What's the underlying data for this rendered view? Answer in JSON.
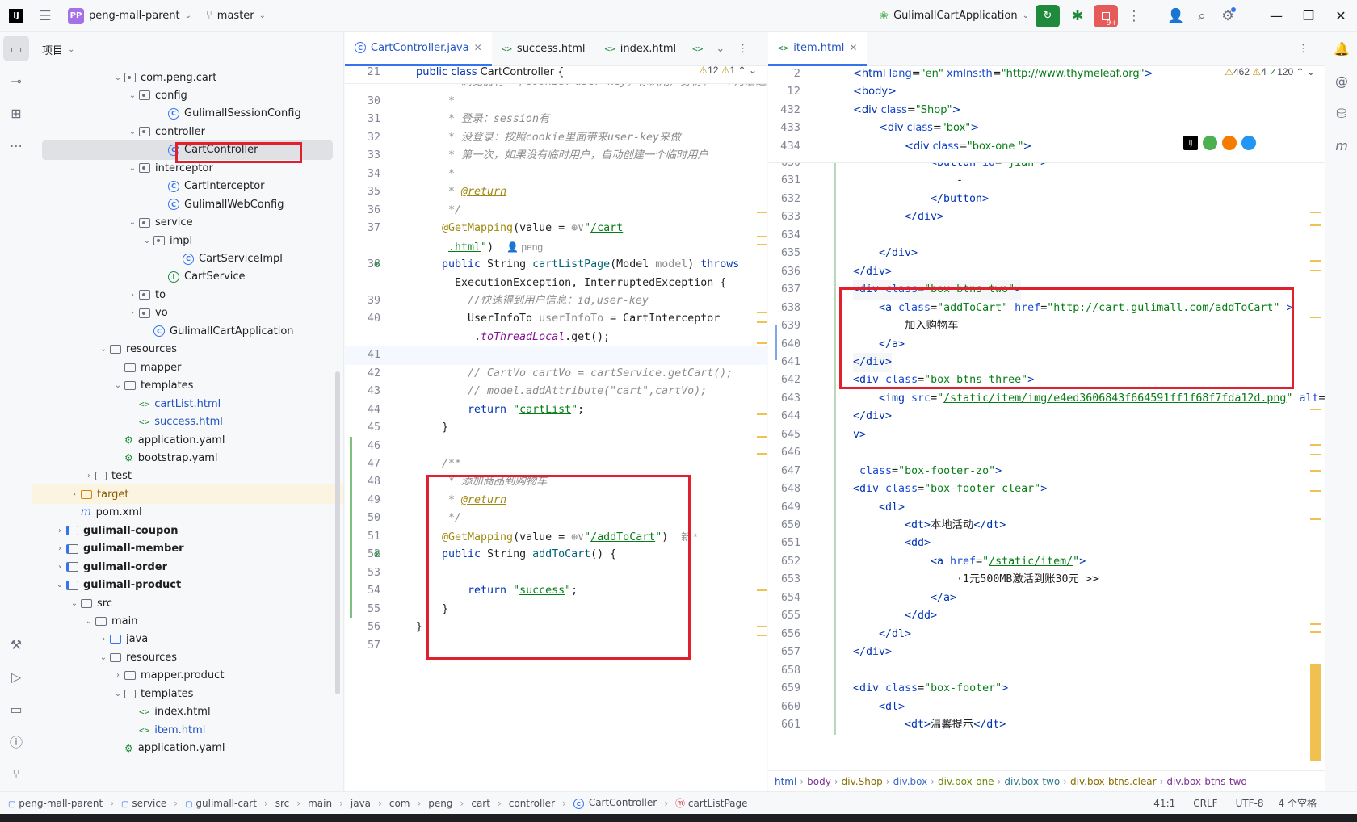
{
  "titlebar": {
    "app_logo": "IJ",
    "project_badge": "PP",
    "project_name": "peng-mall-parent",
    "branch": "master",
    "run_config": "GulimallCartApplication",
    "notif_badge": "9+"
  },
  "project_panel": {
    "title": "项目",
    "tree": [
      {
        "label": "com.peng.cart",
        "icon": "package",
        "depth": 7,
        "arrow": "open"
      },
      {
        "label": "config",
        "icon": "package",
        "depth": 8,
        "arrow": "open"
      },
      {
        "label": "GulimallSessionConfig",
        "icon": "class",
        "depth": 10,
        "arrow": ""
      },
      {
        "label": "controller",
        "icon": "package",
        "depth": 8,
        "arrow": "open"
      },
      {
        "label": "CartController",
        "icon": "class",
        "depth": 10,
        "arrow": "",
        "selected": true,
        "color": "#1e1f22"
      },
      {
        "label": "interceptor",
        "icon": "package",
        "depth": 8,
        "arrow": "open"
      },
      {
        "label": "CartInterceptor",
        "icon": "class",
        "depth": 10,
        "arrow": ""
      },
      {
        "label": "GulimallWebConfig",
        "icon": "class",
        "depth": 10,
        "arrow": ""
      },
      {
        "label": "service",
        "icon": "package",
        "depth": 8,
        "arrow": "open"
      },
      {
        "label": "impl",
        "icon": "package",
        "depth": 9,
        "arrow": "open"
      },
      {
        "label": "CartServiceImpl",
        "icon": "class",
        "depth": 11,
        "arrow": ""
      },
      {
        "label": "CartService",
        "icon": "interface",
        "depth": 10,
        "arrow": ""
      },
      {
        "label": "to",
        "icon": "package",
        "depth": 8,
        "arrow": "closed"
      },
      {
        "label": "vo",
        "icon": "package",
        "depth": 8,
        "arrow": "closed"
      },
      {
        "label": "GulimallCartApplication",
        "icon": "class",
        "depth": 9,
        "arrow": ""
      },
      {
        "label": "resources",
        "icon": "folder",
        "depth": 6,
        "arrow": "open"
      },
      {
        "label": "mapper",
        "icon": "folder",
        "depth": 7,
        "arrow": ""
      },
      {
        "label": "templates",
        "icon": "folder",
        "depth": 7,
        "arrow": "open"
      },
      {
        "label": "cartList.html",
        "icon": "html",
        "depth": 8,
        "arrow": "",
        "color": "#2355c2"
      },
      {
        "label": "success.html",
        "icon": "html",
        "depth": 8,
        "arrow": "",
        "color": "#2355c2"
      },
      {
        "label": "application.yaml",
        "icon": "yaml",
        "depth": 7,
        "arrow": ""
      },
      {
        "label": "bootstrap.yaml",
        "icon": "yaml",
        "depth": 7,
        "arrow": ""
      },
      {
        "label": "test",
        "icon": "folder",
        "depth": 5,
        "arrow": "closed"
      },
      {
        "label": "target",
        "icon": "folder-orange",
        "depth": 4,
        "arrow": "closed",
        "highlight": true,
        "color": "#8a5a00"
      },
      {
        "label": "pom.xml",
        "icon": "maven",
        "depth": 4,
        "arrow": ""
      },
      {
        "label": "gulimall-coupon",
        "icon": "module",
        "depth": 3,
        "arrow": "closed",
        "bold": true
      },
      {
        "label": "gulimall-member",
        "icon": "module",
        "depth": 3,
        "arrow": "closed",
        "bold": true
      },
      {
        "label": "gulimall-order",
        "icon": "module",
        "depth": 3,
        "arrow": "closed",
        "bold": true
      },
      {
        "label": "gulimall-product",
        "icon": "module",
        "depth": 3,
        "arrow": "open",
        "bold": true
      },
      {
        "label": "src",
        "icon": "folder",
        "depth": 4,
        "arrow": "open"
      },
      {
        "label": "main",
        "icon": "folder",
        "depth": 5,
        "arrow": "open"
      },
      {
        "label": "java",
        "icon": "folder-blue",
        "depth": 6,
        "arrow": "closed"
      },
      {
        "label": "resources",
        "icon": "folder",
        "depth": 6,
        "arrow": "open"
      },
      {
        "label": "mapper.product",
        "icon": "folder",
        "depth": 7,
        "arrow": "closed"
      },
      {
        "label": "templates",
        "icon": "folder",
        "depth": 7,
        "arrow": "open"
      },
      {
        "label": "index.html",
        "icon": "html",
        "depth": 8,
        "arrow": ""
      },
      {
        "label": "item.html",
        "icon": "html",
        "depth": 8,
        "arrow": "",
        "color": "#2355c2"
      },
      {
        "label": "application.yaml",
        "icon": "yaml",
        "depth": 7,
        "arrow": ""
      }
    ]
  },
  "left_editor": {
    "tabs": [
      {
        "label": "CartController.java",
        "icon": "C",
        "active": true
      },
      {
        "label": "success.html",
        "icon": "<>",
        "active": false
      },
      {
        "label": "index.html",
        "icon": "<>",
        "active": false
      }
    ],
    "warnings": "12",
    "weak": "1",
    "sticky": {
      "num": "21",
      "html": "<span class=\"kw\">public class</span> CartController {"
    },
    "lines": [
      {
        "num": "30",
        "indent": 1,
        "html": "<span class=\"cm\"> *</span>"
      },
      {
        "num": "31",
        "indent": 1,
        "html": "<span class=\"cm\"> * 登录：session有</span>"
      },
      {
        "num": "32",
        "indent": 1,
        "html": "<span class=\"cm\"> * 没登录：按照cookie里面带来user-key来做</span>"
      },
      {
        "num": "33",
        "indent": 1,
        "html": "<span class=\"cm\"> * 第一次，如果没有临时用户，自动创建一个临时用户</span>"
      },
      {
        "num": "34",
        "indent": 1,
        "html": "<span class=\"cm\"> *</span>"
      },
      {
        "num": "35",
        "indent": 1,
        "html": "<span class=\"cm\"> * </span><span class=\"ann\" style=\"font-style:italic;text-decoration:underline\">@return</span>"
      },
      {
        "num": "36",
        "indent": 1,
        "html": "<span class=\"cm\"> */</span>"
      },
      {
        "num": "37",
        "indent": 1,
        "html": "<span class=\"ann\">@GetMapping</span>(value = <span class=\"gray\">⊕∨</span><span class=\"str\">\"<u>/cart</u></span>"
      },
      {
        "num": "",
        "indent": 1,
        "html": "<span class=\"str\"> <u>.html</u>\"</span>)  <span class=\"gray\" style=\"font-family:'Liberation Sans',sans-serif;font-size:12px\">👤 peng</span>"
      },
      {
        "num": "38",
        "indent": 1,
        "html": "<span class=\"kw\">public</span> String <span class=\"fn\">cartListPage</span>(Model <span class=\"gray\">model</span>) <span class=\"kw\">throws</span>"
      },
      {
        "num": "",
        "indent": 1,
        "html": "  ExecutionException, InterruptedException {"
      },
      {
        "num": "39",
        "indent": 2,
        "html": "<span class=\"cm\">//快速得到用户信息：id,user-key</span>"
      },
      {
        "num": "40",
        "indent": 2,
        "html": "UserInfoTo <span class=\"gray\">userInfoTo</span> = CartInterceptor"
      },
      {
        "num": "",
        "indent": 2,
        "html": " .<span class=\"ital\">toThreadLocal</span>.get();"
      },
      {
        "num": "41",
        "indent": 2,
        "html": ""
      },
      {
        "num": "42",
        "indent": 2,
        "html": "<span class=\"cm\">// CartVo cartVo = cartService.getCart();</span>"
      },
      {
        "num": "43",
        "indent": 2,
        "html": "<span class=\"cm\">// model.addAttribute(\"cart\",cartVo);</span>"
      },
      {
        "num": "44",
        "indent": 2,
        "html": "<span class=\"kw\">return</span> <span class=\"str\">\"<u>cartList</u>\"</span>;"
      },
      {
        "num": "45",
        "indent": 1,
        "html": "}"
      },
      {
        "num": "46",
        "indent": 1,
        "html": ""
      },
      {
        "num": "47",
        "indent": 1,
        "html": "<span class=\"cm\">/**</span>"
      },
      {
        "num": "48",
        "indent": 1,
        "html": "<span class=\"cm\"> * 添加商品到购物车</span>"
      },
      {
        "num": "49",
        "indent": 1,
        "html": "<span class=\"cm\"> * </span><span class=\"ann\" style=\"font-style:italic;text-decoration:underline\">@return</span>"
      },
      {
        "num": "50",
        "indent": 1,
        "html": "<span class=\"cm\"> */</span>"
      },
      {
        "num": "51",
        "indent": 1,
        "html": "<span class=\"ann\">@GetMapping</span>(value = <span class=\"gray\">⊕∨</span><span class=\"str\">\"<u>/addToCart</u>\"</span>)  <span class=\"gray\" style=\"font-family:'Liberation Sans',sans-serif;font-size:12px\">新 *</span>"
      },
      {
        "num": "52",
        "indent": 1,
        "html": "<span class=\"kw\">public</span> String <span class=\"fn\">addToCart</span>() {"
      },
      {
        "num": "53",
        "indent": 1,
        "html": ""
      },
      {
        "num": "54",
        "indent": 2,
        "html": "<span class=\"kw\">return</span> <span class=\"str\">\"<u>success</u>\"</span>;"
      },
      {
        "num": "55",
        "indent": 1,
        "html": "}"
      },
      {
        "num": "56",
        "indent": 0,
        "html": "}"
      },
      {
        "num": "57",
        "indent": 0,
        "html": ""
      }
    ],
    "top_partial": "<span class=\"cm\"> * 浏览器有一个cookie：user-key，标识用户身份，一个月后过期</span>"
  },
  "right_editor": {
    "tabs": [
      {
        "label": "item.html",
        "icon": "<>",
        "active": true
      }
    ],
    "warnings": "462",
    "weak": "4",
    "ok": "120",
    "sticky": [
      {
        "num": "2",
        "indent": 0,
        "html": "<span class=\"tag\">&lt;html</span> <span class=\"attr\">lang</span>=<span class=\"aval\">\"en\"</span> <span class=\"attr\">xmlns:th</span>=<span class=\"aval\">\"http://www.thymeleaf.org\"</span><span class=\"tag\">&gt;</span>"
      },
      {
        "num": "12",
        "indent": 0,
        "html": "<span class=\"tag\">&lt;body&gt;</span>"
      },
      {
        "num": "432",
        "indent": 0,
        "html": "<span class=\"tag\">&lt;div</span> <span class=\"attr\">class</span>=<span class=\"aval\">\"Shop\"</span><span class=\"tag\">&gt;</span>"
      },
      {
        "num": "433",
        "indent": 1,
        "html": "<span class=\"tag\">&lt;div</span> <span class=\"attr\">class</span>=<span class=\"aval\">\"box\"</span><span class=\"tag\">&gt;</span>"
      },
      {
        "num": "434",
        "indent": 2,
        "html": "<span class=\"tag\">&lt;div</span> <span class=\"attr\">class</span>=<span class=\"aval\">\"box-one \"</span><span class=\"tag\">&gt;</span>"
      }
    ],
    "lines": [
      {
        "num": "630",
        "indent": 3,
        "html": "<span class=\"tag\">&lt;button</span> <span class=\"attr\">id</span>=<span class=\"aval\">\"jian\"</span><span class=\"tag\">&gt;</span>"
      },
      {
        "num": "631",
        "indent": 4,
        "html": "-"
      },
      {
        "num": "632",
        "indent": 3,
        "html": "<span class=\"tag\">&lt;/button&gt;</span>"
      },
      {
        "num": "633",
        "indent": 2,
        "html": "<span class=\"tag\">&lt;/div&gt;</span>"
      },
      {
        "num": "634",
        "indent": 0,
        "html": ""
      },
      {
        "num": "635",
        "indent": 1,
        "html": "<span class=\"tag\">&lt;/div&gt;</span>"
      },
      {
        "num": "636",
        "indent": 0,
        "html": "<span class=\"tag\">&lt;/div&gt;</span>"
      },
      {
        "num": "637",
        "indent": 0,
        "html": "<span class=\"tag\">&lt;div</span> <span class=\"attr\">class</span>=<span class=\"aval\">\"box-btns-two\"</span><span class=\"tag\">&gt;</span>"
      },
      {
        "num": "638",
        "indent": 1,
        "html": "<span class=\"tag\">&lt;a</span> <span class=\"attr\">class</span>=<span class=\"aval\">\"addToCart\"</span> <span class=\"attr\">href</span>=<span class=\"aval\">\"<u>http://cart.gulimall.com/addToCart</u>\"</span> <span class=\"tag\">&gt;</span>"
      },
      {
        "num": "639",
        "indent": 2,
        "html": "加入购物车"
      },
      {
        "num": "640",
        "indent": 1,
        "html": "<span class=\"tag\">&lt;/a&gt;</span>"
      },
      {
        "num": "641",
        "indent": 0,
        "html": "<span class=\"tag\">&lt;/div&gt;</span>"
      },
      {
        "num": "642",
        "indent": 0,
        "html": "<span class=\"tag\">&lt;div</span> <span class=\"attr\">class</span>=<span class=\"aval\">\"box-btns-three\"</span><span class=\"tag\">&gt;</span>"
      },
      {
        "num": "643",
        "indent": 1,
        "html": "<span class=\"tag\">&lt;img</span> <span class=\"attr\">src</span>=<span class=\"aval\">\"<u>/static/item/img/e4ed3606843f664591ff1f68f7fda12d.png</u>\"</span> <span class=\"attr\">alt</span>=<span class=\"aval\">\"\"</span>"
      },
      {
        "num": "644",
        "indent": 0,
        "html": "<span class=\"tag\">&lt;/div&gt;</span>"
      },
      {
        "num": "645",
        "indent": 0,
        "html": "<span class=\"tag\">v&gt;</span>"
      },
      {
        "num": "646",
        "indent": 0,
        "html": ""
      },
      {
        "num": "647",
        "indent": 0,
        "html": " <span class=\"attr\">class</span>=<span class=\"aval\">\"box-footer-zo\"</span><span class=\"tag\">&gt;</span>"
      },
      {
        "num": "648",
        "indent": 0,
        "html": "<span class=\"tag\">&lt;div</span> <span class=\"attr\">class</span>=<span class=\"aval\">\"box-footer clear\"</span><span class=\"tag\">&gt;</span>"
      },
      {
        "num": "649",
        "indent": 1,
        "html": "<span class=\"tag\">&lt;dl&gt;</span>"
      },
      {
        "num": "650",
        "indent": 2,
        "html": "<span class=\"tag\">&lt;dt&gt;</span>本地活动<span class=\"tag\">&lt;/dt&gt;</span>"
      },
      {
        "num": "651",
        "indent": 2,
        "html": "<span class=\"tag\">&lt;dd&gt;</span>"
      },
      {
        "num": "652",
        "indent": 3,
        "html": "<span class=\"tag\">&lt;a</span> <span class=\"attr\">href</span>=<span class=\"aval\">\"<u>/static/item/</u>\"</span><span class=\"tag\">&gt;</span>"
      },
      {
        "num": "653",
        "indent": 4,
        "html": "·1元500MB激活到账30元 &gt;&gt;"
      },
      {
        "num": "654",
        "indent": 3,
        "html": "<span class=\"tag\">&lt;/a&gt;</span>"
      },
      {
        "num": "655",
        "indent": 2,
        "html": "<span class=\"tag\">&lt;/dd&gt;</span>"
      },
      {
        "num": "656",
        "indent": 1,
        "html": "<span class=\"tag\">&lt;/dl&gt;</span>"
      },
      {
        "num": "657",
        "indent": 0,
        "html": "<span class=\"tag\">&lt;/div&gt;</span>"
      },
      {
        "num": "658",
        "indent": 0,
        "html": ""
      },
      {
        "num": "659",
        "indent": 0,
        "html": "<span class=\"tag\">&lt;div</span> <span class=\"attr\">class</span>=<span class=\"aval\">\"box-footer\"</span><span class=\"tag\">&gt;</span>"
      },
      {
        "num": "660",
        "indent": 1,
        "html": "<span class=\"tag\">&lt;dl&gt;</span>"
      },
      {
        "num": "661",
        "indent": 2,
        "html": "<span class=\"tag\">&lt;dt&gt;</span>温馨提示<span class=\"tag\">&lt;/dt&gt;</span>"
      }
    ],
    "breadcrumb": [
      "html",
      "body",
      "div.Shop",
      "div.box",
      "div.box-one",
      "div.box-two",
      "div.box-btns.clear",
      "div.box-btns-two"
    ]
  },
  "statusbar": {
    "path": [
      "peng-mall-parent",
      "service",
      "gulimall-cart",
      "src",
      "main",
      "java",
      "com",
      "peng",
      "cart",
      "controller",
      "CartController",
      "cartListPage"
    ],
    "position": "41:1",
    "line_sep": "CRLF",
    "encoding": "UTF-8",
    "indent": "4 个空格"
  }
}
